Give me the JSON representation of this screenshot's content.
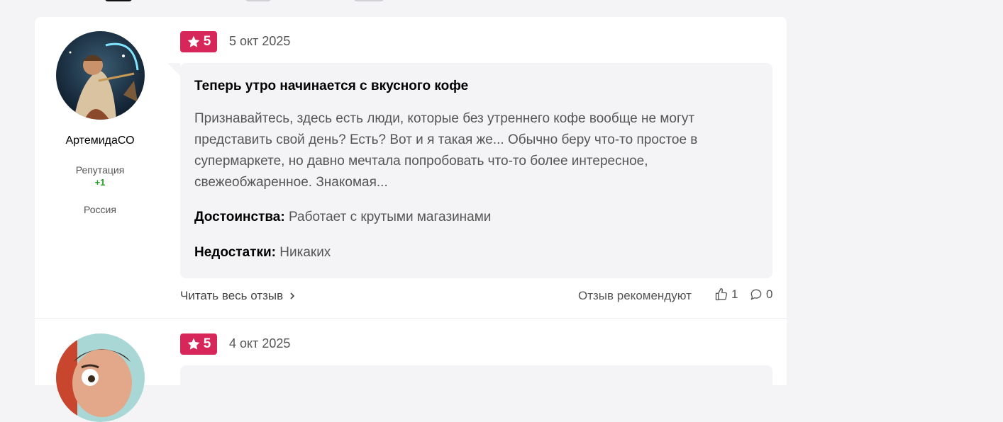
{
  "colors": {
    "page_bg": "#f4f4f6",
    "badge": "#d7265a",
    "reputation": "#2aa02a"
  },
  "reviews": [
    {
      "author": "АртемидаСО",
      "reputation_label": "Репутация",
      "reputation_value": "+1",
      "country": "Россия",
      "rating": "5",
      "date": "5 окт 2025",
      "title": "Теперь утро начинается с вкусного кофе",
      "text": "Признавайтесь, здесь есть люди, которые без утреннего кофе вообще не могут представить свой день? Есть? Вот и я такая же... Обычно беру что-то простое в супермаркете, но давно мечтала попробовать что-то более интересное, свежеобжаренное. Знакомая...",
      "pros_label": "Достоинства:",
      "pros": "Работает с крутыми магазинами",
      "cons_label": "Недостатки:",
      "cons": "Никаких",
      "read_more": "Читать весь отзыв",
      "recommend_label": "Отзыв рекомендуют",
      "likes": "1",
      "comments": "0"
    },
    {
      "rating": "5",
      "date": "4 окт 2025"
    }
  ]
}
